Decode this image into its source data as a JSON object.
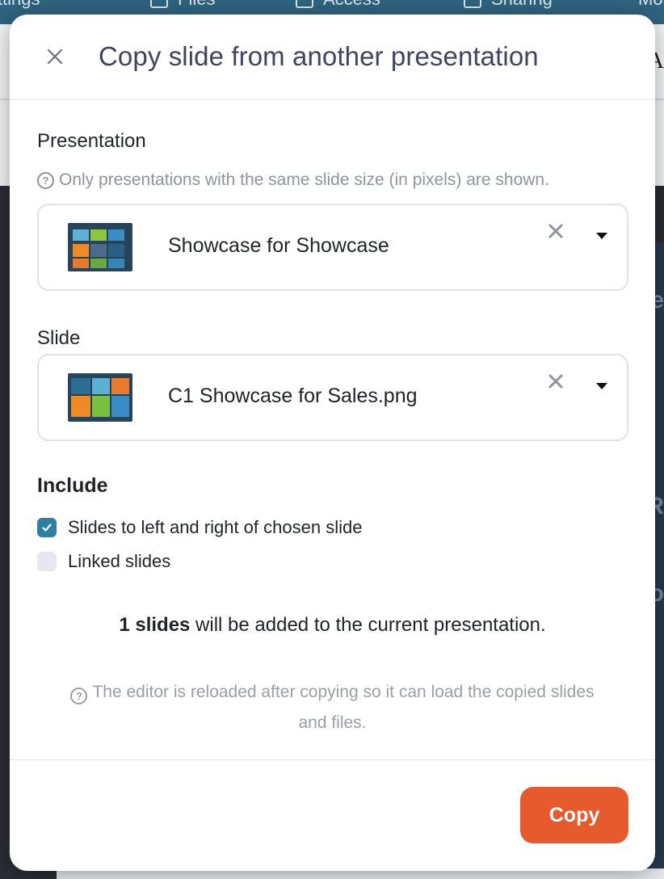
{
  "background": {
    "tabs": [
      {
        "label": "Settings",
        "icon": "settings-icon"
      },
      {
        "label": "Files",
        "icon": "file-icon"
      },
      {
        "label": "Access",
        "icon": "lock-icon"
      },
      {
        "label": "Sharing",
        "icon": "share-icon"
      },
      {
        "label": "Mo",
        "icon": ""
      }
    ],
    "side_letter": "A",
    "right_letters": [
      "e",
      "R",
      "o"
    ]
  },
  "modal": {
    "title": "Copy slide from another presentation",
    "close_icon": "close-icon",
    "presentation": {
      "label": "Presentation",
      "hint": "Only presentations with the same slide size (in pixels) are shown.",
      "selected": "Showcase for Showcase"
    },
    "slide": {
      "label": "Slide",
      "selected": "C1 Showcase for Sales.png"
    },
    "include": {
      "title": "Include",
      "options": [
        {
          "label": "Slides to left and right of chosen slide",
          "checked": true
        },
        {
          "label": "Linked slides",
          "checked": false
        }
      ]
    },
    "summary": {
      "count": "1 slides",
      "text": " will be added to the current presentation."
    },
    "note": "The editor is reloaded after copying so it can load the copied slides and files.",
    "copy_button": "Copy"
  },
  "colors": {
    "accent": "#e65a2e",
    "checkbox": "#2f7fa3",
    "title": "#3f4560"
  }
}
